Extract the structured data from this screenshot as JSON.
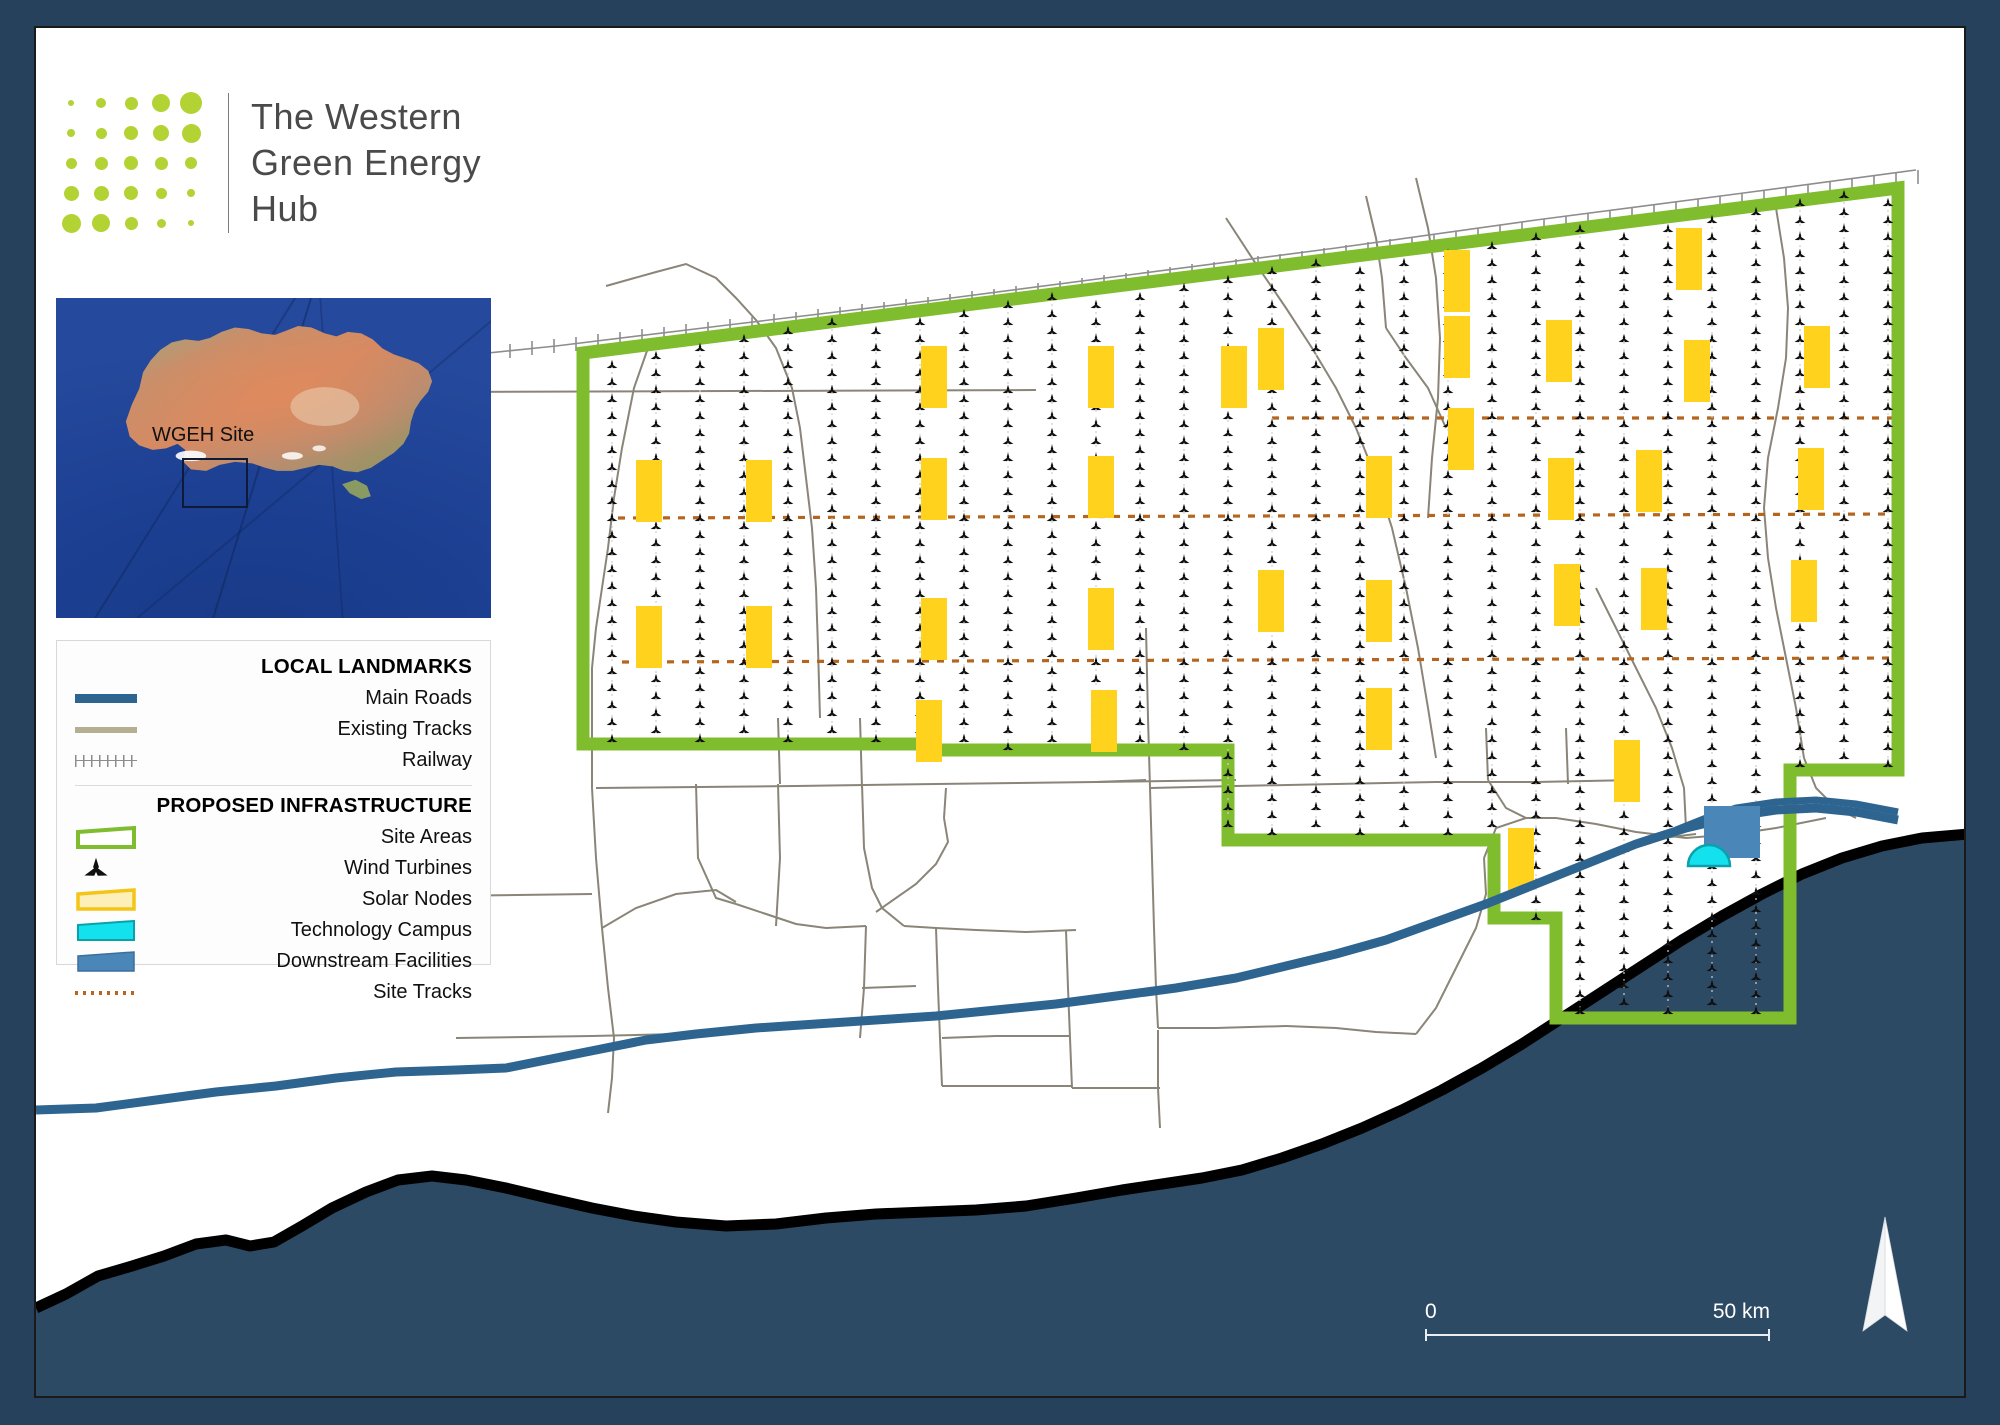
{
  "brand": {
    "logo_icon": "green-dot-grid-logo",
    "name_line1": "The Western",
    "name_line2": "Green Energy",
    "name_line3": "Hub",
    "logo_dot_color": "#b3d234",
    "wordmark_color": "#4a4a4a"
  },
  "inset": {
    "icon": "australia-locator-map",
    "site_label": "WGEH Site",
    "site_box_icon": "site-extent-rectangle"
  },
  "legend": {
    "sections": [
      {
        "title": "LOCAL LANDMARKS",
        "items": [
          {
            "label": "Main Roads",
            "symbol": "solid-line-swatch",
            "color": "#2e6590"
          },
          {
            "label": "Existing Tracks",
            "symbol": "solid-line-swatch",
            "color": "#b4ae92"
          },
          {
            "label": "Railway",
            "symbol": "hatched-line-swatch",
            "color": "#8d8d8d"
          }
        ]
      },
      {
        "title": "PROPOSED INFRASTRUCTURE",
        "items": [
          {
            "label": "Site Areas",
            "symbol": "outlined-polygon-swatch",
            "color": "#7fbc2e"
          },
          {
            "label": "Wind Turbines",
            "symbol": "wind-turbine-icon",
            "color": "#101010"
          },
          {
            "label": "Solar Nodes",
            "symbol": "filled-polygon-swatch",
            "color": "#ffd21e"
          },
          {
            "label": "Technology Campus",
            "symbol": "filled-polygon-swatch",
            "color": "#14e1ee"
          },
          {
            "label": "Downstream Facilities",
            "symbol": "filled-polygon-swatch",
            "color": "#4a86b8"
          },
          {
            "label": "Site Tracks",
            "symbol": "dotted-line-swatch",
            "color": "#b5651d"
          }
        ]
      }
    ]
  },
  "scale": {
    "start_label": "0",
    "end_label": "50 km"
  },
  "north_arrow": {
    "icon": "north-arrow-icon"
  },
  "map": {
    "colors": {
      "frame": "#26415c",
      "ocean": "#2c4a63",
      "coastline": "#000000",
      "site_boundary": "#7fbc2e",
      "main_road": "#2e6590",
      "existing_track": "#8a8578",
      "railway": "#8d8d8d",
      "site_track": "#b5651d",
      "solar_node": "#ffd21e",
      "tech_campus": "#14e1ee",
      "downstream": "#4a86b8",
      "turbine": "#101010",
      "land": "#ffffff"
    },
    "features": {
      "site_area": "wgeh-site-boundary",
      "wind_farm": "wind-turbine-array",
      "solar_nodes_count": 31,
      "technology_campus_count": 1,
      "downstream_facility_count": 1,
      "site_track_lines": 3
    }
  }
}
